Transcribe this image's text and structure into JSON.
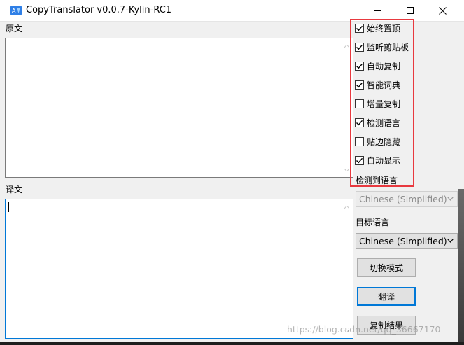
{
  "window": {
    "title": "CopyTranslator v0.0.7-Kylin-RC1"
  },
  "source": {
    "label": "原文",
    "value": ""
  },
  "result": {
    "label": "译文",
    "value": ""
  },
  "options": [
    {
      "label": "始终置顶",
      "checked": true
    },
    {
      "label": "监听剪贴板",
      "checked": true
    },
    {
      "label": "自动复制",
      "checked": true
    },
    {
      "label": "智能词典",
      "checked": true
    },
    {
      "label": "增量复制",
      "checked": false
    },
    {
      "label": "检测语言",
      "checked": true
    },
    {
      "label": "贴边隐藏",
      "checked": false
    },
    {
      "label": "自动显示",
      "checked": true
    }
  ],
  "detected": {
    "label": "检测到语言",
    "value": "Chinese (Simplified)"
  },
  "target": {
    "label": "目标语言",
    "value": "Chinese (Simplified)"
  },
  "buttons": {
    "switch_mode": "切换模式",
    "translate": "翻译",
    "copy_result": "复制结果"
  },
  "watermark": "https://blog.csdn.net/qq_36667170",
  "colors": {
    "highlight": "#e8393f",
    "focus": "#0078d7",
    "app_icon": "#2f7fe6"
  }
}
